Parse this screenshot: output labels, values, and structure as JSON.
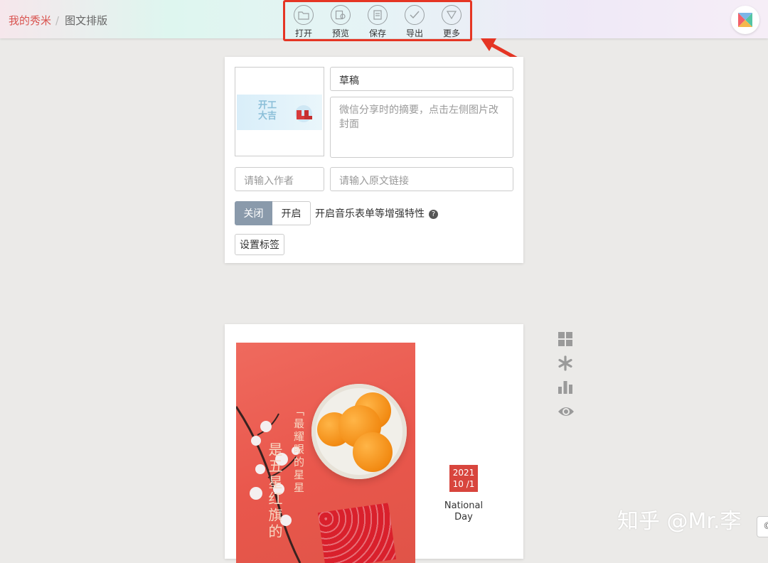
{
  "breadcrumb": {
    "home": "我的秀米",
    "current": "图文排版"
  },
  "toolbar": {
    "open": "打开",
    "preview": "预览",
    "save": "保存",
    "export": "导出",
    "more": "更多"
  },
  "article": {
    "title": "草稿",
    "summary_placeholder": "微信分享时的摘要，点击左侧图片改封面",
    "author_placeholder": "请输入作者",
    "link_placeholder": "请输入原文链接",
    "cover_text": "开工大吉"
  },
  "toggle": {
    "off": "关闭",
    "on": "开启",
    "selected": "关闭",
    "feature_label": "开启音乐表单等增强特性"
  },
  "tag_button": "设置标签",
  "poster": {
    "vertical_1": "「最耀眼的星星",
    "vertical_2": "是五星红旗的",
    "date_year": "2021",
    "date_day": "10 /1",
    "national": "National",
    "day": "Day"
  },
  "watermark": "知乎 @Mr.李",
  "colors": {
    "accent_red": "#e53524",
    "home_link": "#d9534f",
    "toggle_active": "#8a9aab",
    "date_box": "#d8453d"
  }
}
